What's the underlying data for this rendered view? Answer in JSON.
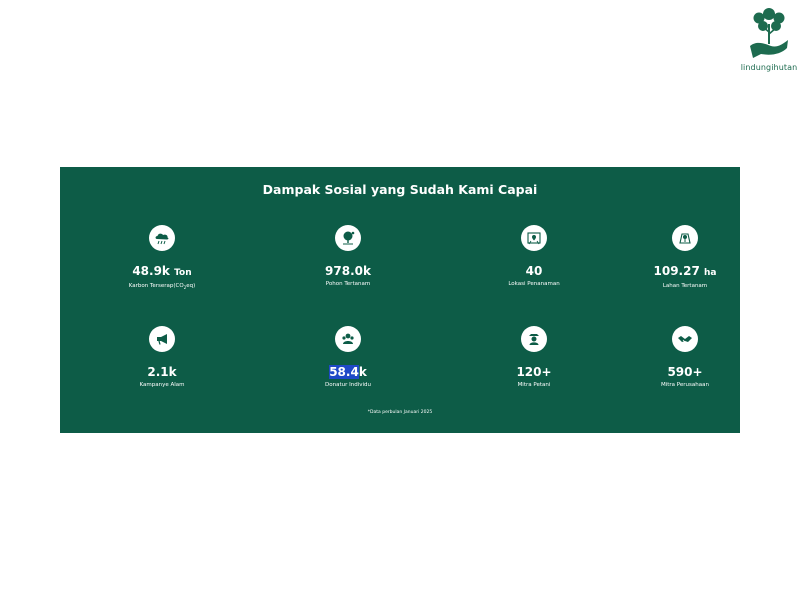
{
  "brand": {
    "name": "lindungihutan"
  },
  "impact": {
    "title": "Dampak Sosial yang Sudah Kami Capai",
    "stats": [
      {
        "value": "48.9k",
        "unit": "Ton",
        "label_prefix": "Karbon Terserap(CO",
        "label_sub": "2",
        "label_suffix": "eq)",
        "icon": "cloud-rain-icon"
      },
      {
        "value": "978.0k",
        "unit": "",
        "label": "Pohon Tertanam",
        "icon": "tree-icon"
      },
      {
        "value": "40",
        "unit": "",
        "label": "Lokasi Penanaman",
        "icon": "location-map-icon"
      },
      {
        "value": "109.27",
        "unit": "ha",
        "label": "Lahan Tertanam",
        "icon": "land-area-icon"
      },
      {
        "value": "2.1k",
        "unit": "",
        "label": "Kampanye Alam",
        "icon": "megaphone-icon"
      },
      {
        "value_highlight": "58.4",
        "value_rest": "k",
        "unit": "",
        "label": "Donatur Individu",
        "icon": "donor-icon"
      },
      {
        "value": "120+",
        "unit": "",
        "label": "Mitra Petani",
        "icon": "farmer-icon"
      },
      {
        "value": "590+",
        "unit": "",
        "label": "Mitra Perusahaan",
        "icon": "handshake-icon"
      }
    ],
    "note": "*Data perbulan Januari 2025"
  },
  "colors": {
    "panel_bg": "#0d5c47",
    "brand_green": "#1d6b4f",
    "highlight": "#1f49c7"
  }
}
